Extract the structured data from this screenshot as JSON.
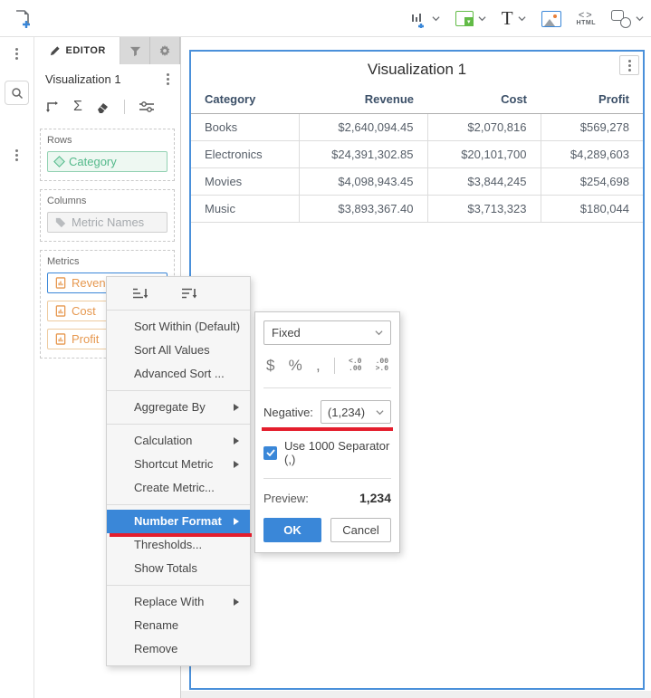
{
  "topbar": {
    "tools": [
      {
        "name": "add-visualization"
      },
      {
        "name": "add-filter"
      },
      {
        "name": "add-text",
        "label": "T"
      },
      {
        "name": "add-image"
      },
      {
        "name": "add-html",
        "label": "HTML"
      },
      {
        "name": "add-shapes"
      }
    ]
  },
  "editor_panel": {
    "tab_label": "EDITOR",
    "title": "Visualization 1",
    "sections": {
      "rows": {
        "label": "Rows",
        "chips": [
          {
            "label": "Category"
          }
        ]
      },
      "columns": {
        "label": "Columns",
        "chips": [
          {
            "label": "Metric Names"
          }
        ]
      },
      "metrics": {
        "label": "Metrics",
        "chips": [
          {
            "label": "Revenue",
            "selected": true
          },
          {
            "label": "Cost",
            "selected": false
          },
          {
            "label": "Profit",
            "selected": false
          }
        ]
      }
    }
  },
  "visualization": {
    "title": "Visualization 1",
    "table": {
      "columns": [
        "Category",
        "Revenue",
        "Cost",
        "Profit"
      ],
      "rows": [
        [
          "Books",
          "$2,640,094.45",
          "$2,070,816",
          "$569,278"
        ],
        [
          "Electronics",
          "$24,391,302.85",
          "$20,101,700",
          "$4,289,603"
        ],
        [
          "Movies",
          "$4,098,943.45",
          "$3,844,245",
          "$254,698"
        ],
        [
          "Music",
          "$3,893,367.40",
          "$3,713,323",
          "$180,044"
        ]
      ]
    }
  },
  "context_menu": {
    "items": [
      {
        "label": "Sort Within (Default)",
        "submenu": false,
        "highlighted": false
      },
      {
        "label": "Sort All Values",
        "submenu": false,
        "highlighted": false
      },
      {
        "label": "Advanced Sort ...",
        "submenu": false,
        "highlighted": false
      },
      {
        "label": "Aggregate By",
        "submenu": true,
        "highlighted": false
      },
      {
        "label": "Calculation",
        "submenu": true,
        "highlighted": false
      },
      {
        "label": "Shortcut Metric",
        "submenu": true,
        "highlighted": false
      },
      {
        "label": "Create Metric...",
        "submenu": false,
        "highlighted": false
      },
      {
        "label": "Number Format",
        "submenu": true,
        "highlighted": true
      },
      {
        "label": "Thresholds...",
        "submenu": false,
        "highlighted": false
      },
      {
        "label": "Show Totals",
        "submenu": false,
        "highlighted": false
      },
      {
        "label": "Replace With",
        "submenu": true,
        "highlighted": false
      },
      {
        "label": "Rename",
        "submenu": false,
        "highlighted": false
      },
      {
        "label": "Remove",
        "submenu": false,
        "highlighted": false
      }
    ]
  },
  "number_format_popup": {
    "format_value": "Fixed",
    "icons": {
      "currency": "$",
      "percent": "%",
      "comma": ",",
      "decrease_decimal_top": "<.0",
      "decrease_decimal_bottom": ".00",
      "increase_decimal_top": ".00",
      "increase_decimal_bottom": ">.0"
    },
    "negative_label": "Negative:",
    "negative_value": "(1,234)",
    "separator_label": "Use 1000 Separator (,)",
    "separator_checked": true,
    "preview_label": "Preview:",
    "preview_value": "1,234",
    "ok_label": "OK",
    "cancel_label": "Cancel"
  },
  "colors": {
    "accent_blue": "#3a87d8",
    "container_border_blue": "#4a90da",
    "annotation_red": "#e41e2d",
    "chip_teal": "#54b98b",
    "chip_orange": "#e6984f",
    "tool_green": "#62bb46"
  }
}
